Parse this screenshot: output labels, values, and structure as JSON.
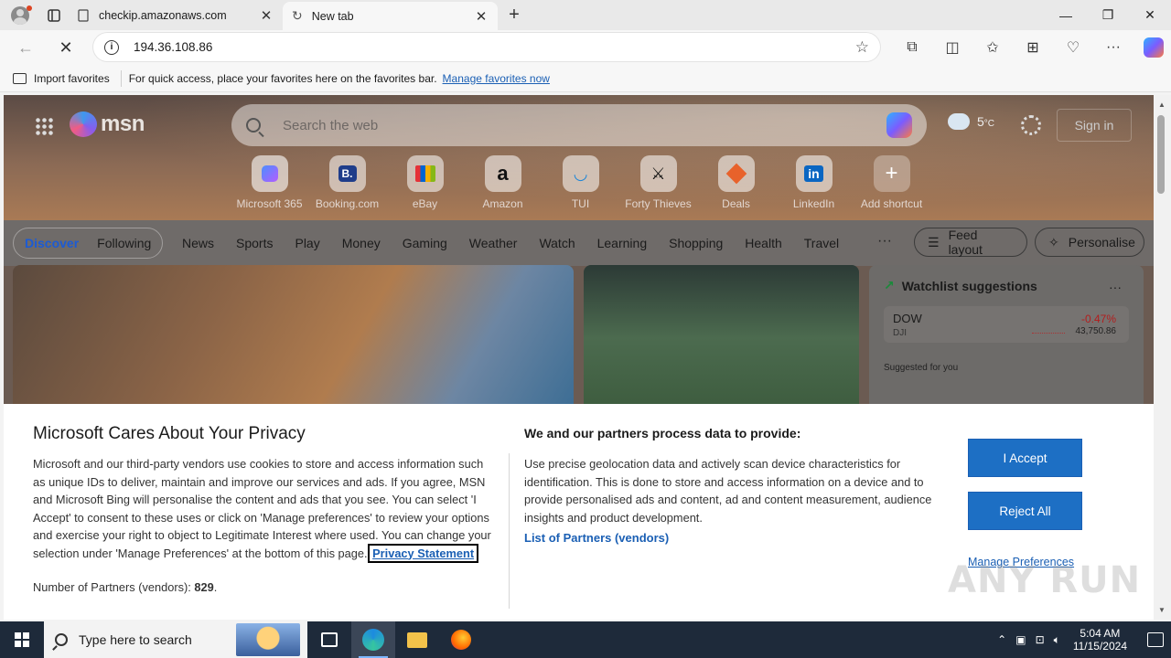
{
  "browser": {
    "tabs": [
      {
        "label": "checkip.amazonaws.com",
        "active": false
      },
      {
        "label": "New tab",
        "active": true
      }
    ],
    "url": "194.36.108.86",
    "favorites_bar": {
      "import_label": "Import favorites",
      "message": "For quick access, place your favorites here on the favorites bar.",
      "manage_link": "Manage favorites now"
    }
  },
  "msn": {
    "logo_text": "msn",
    "search_placeholder": "Search the web",
    "weather_temp": "5",
    "weather_unit": "°C",
    "signin_label": "Sign in",
    "shortcuts": [
      {
        "label": "Microsoft 365",
        "icon": "microsoft365-icon"
      },
      {
        "label": "Booking.com",
        "icon": "booking-icon",
        "glyph": "B."
      },
      {
        "label": "eBay",
        "icon": "ebay-icon"
      },
      {
        "label": "Amazon",
        "icon": "amazon-icon",
        "glyph": "a"
      },
      {
        "label": "TUI",
        "icon": "tui-icon"
      },
      {
        "label": "Forty Thieves",
        "icon": "forty-thieves-icon"
      },
      {
        "label": "Deals",
        "icon": "deals-icon"
      },
      {
        "label": "LinkedIn",
        "icon": "linkedin-icon",
        "glyph": "in"
      },
      {
        "label": "Add shortcut",
        "icon": "plus-icon",
        "glyph": "+"
      }
    ],
    "nav": {
      "discover": "Discover",
      "following": "Following",
      "categories": [
        "News",
        "Sports",
        "Play",
        "Money",
        "Gaming",
        "Weather",
        "Watch",
        "Learning",
        "Shopping",
        "Health",
        "Travel"
      ],
      "more": "···",
      "feed_layout": "Feed layout",
      "personalise": "Personalise"
    },
    "watchlist": {
      "title": "Watchlist suggestions",
      "items": [
        {
          "symbol": "DOW",
          "name": "DJI",
          "change": "-0.47%",
          "price": "43,750.86"
        }
      ],
      "suggested_label": "Suggested for you"
    }
  },
  "consent": {
    "title": "Microsoft Cares About Your Privacy",
    "body": "Microsoft and our third-party vendors use cookies to store and access information such as unique IDs to deliver, maintain and improve our services and ads. If you agree, MSN and Microsoft Bing will personalise the content and ads that you see. You can select 'I Accept' to consent to these uses or click on 'Manage preferences' to review your options and exercise your right to object to Legitimate Interest where used.  You can change your selection under 'Manage Preferences' at the bottom of this page.",
    "privacy_link": "Privacy Statement",
    "partners_label": "Number of Partners (vendors):",
    "partners_count": "829",
    "right_title": "We and our partners process data to provide:",
    "right_body": "Use precise geolocation data and actively scan device characteristics for identification. This is done to store and access information on a device and to provide personalised ads and content, ad and content measurement, audience insights and product development.",
    "list_link": "List of Partners (vendors)",
    "accept": "I Accept",
    "reject": "Reject All",
    "manage": "Manage Preferences"
  },
  "watermark": "ANY RUN",
  "taskbar": {
    "search_placeholder": "Type here to search",
    "time": "5:04 AM",
    "date": "11/15/2024"
  }
}
